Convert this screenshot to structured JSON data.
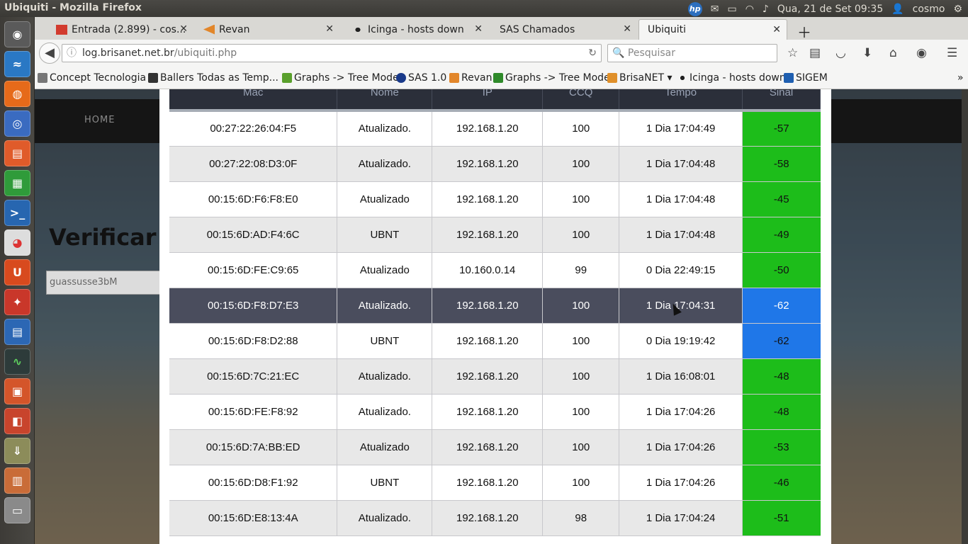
{
  "window_title": "Ubiquiti - Mozilla Firefox",
  "panel": {
    "datetime": "Qua, 21 de Set 09:35",
    "user": "cosmo"
  },
  "tabs": [
    {
      "label": "Entrada (2.899) - cos...",
      "active": false
    },
    {
      "label": "Revan",
      "active": false
    },
    {
      "label": "Icinga - hosts down",
      "active": false
    },
    {
      "label": "SAS Chamados",
      "active": false
    },
    {
      "label": "Ubiquiti",
      "active": true
    }
  ],
  "address": {
    "domain": "log.brisanet.net.br",
    "path": "/ubiquiti.php"
  },
  "search": {
    "placeholder": "Pesquisar"
  },
  "bookmarks": [
    "Concept Tecnologia",
    "Ballers Todas as Temp...",
    "Graphs -> Tree Mode",
    "SAS 1.0",
    "Revan",
    "Graphs -> Tree Mode",
    "BrisaNET",
    "Icinga - hosts down",
    "SIGEM"
  ],
  "site": {
    "nav_home": "HOME",
    "title": "Verificar",
    "input_value": "guassusse3bM"
  },
  "table": {
    "columns": [
      "Mac",
      "Nome",
      "IP",
      "CCQ",
      "Tempo",
      "Sinal"
    ],
    "rows": [
      {
        "mac": "00:27:22:26:04:F5",
        "nome": "Atualizado.",
        "ip": "192.168.1.20",
        "ccq": "100",
        "tempo": "1 Dia 17:04:49",
        "sinal": "-57",
        "color": "green"
      },
      {
        "mac": "00:27:22:08:D3:0F",
        "nome": "Atualizado.",
        "ip": "192.168.1.20",
        "ccq": "100",
        "tempo": "1 Dia 17:04:48",
        "sinal": "-58",
        "color": "green"
      },
      {
        "mac": "00:15:6D:F6:F8:E0",
        "nome": "Atualizado",
        "ip": "192.168.1.20",
        "ccq": "100",
        "tempo": "1 Dia 17:04:48",
        "sinal": "-45",
        "color": "green"
      },
      {
        "mac": "00:15:6D:AD:F4:6C",
        "nome": "UBNT",
        "ip": "192.168.1.20",
        "ccq": "100",
        "tempo": "1 Dia 17:04:48",
        "sinal": "-49",
        "color": "green"
      },
      {
        "mac": "00:15:6D:FE:C9:65",
        "nome": "Atualizado",
        "ip": "10.160.0.14",
        "ccq": "99",
        "tempo": "0 Dia 22:49:15",
        "sinal": "-50",
        "color": "green"
      },
      {
        "mac": "00:15:6D:F8:D7:E3",
        "nome": "Atualizado.",
        "ip": "192.168.1.20",
        "ccq": "100",
        "tempo": "1 Dia 17:04:31",
        "sinal": "-62",
        "color": "blue",
        "highlight": true
      },
      {
        "mac": "00:15:6D:F8:D2:88",
        "nome": "UBNT",
        "ip": "192.168.1.20",
        "ccq": "100",
        "tempo": "0 Dia 19:19:42",
        "sinal": "-62",
        "color": "blue"
      },
      {
        "mac": "00:15:6D:7C:21:EC",
        "nome": "Atualizado.",
        "ip": "192.168.1.20",
        "ccq": "100",
        "tempo": "1 Dia 16:08:01",
        "sinal": "-48",
        "color": "green"
      },
      {
        "mac": "00:15:6D:FE:F8:92",
        "nome": "Atualizado.",
        "ip": "192.168.1.20",
        "ccq": "100",
        "tempo": "1 Dia 17:04:26",
        "sinal": "-48",
        "color": "green"
      },
      {
        "mac": "00:15:6D:7A:BB:ED",
        "nome": "Atualizado",
        "ip": "192.168.1.20",
        "ccq": "100",
        "tempo": "1 Dia 17:04:26",
        "sinal": "-53",
        "color": "green"
      },
      {
        "mac": "00:15:6D:D8:F1:92",
        "nome": "UBNT",
        "ip": "192.168.1.20",
        "ccq": "100",
        "tempo": "1 Dia 17:04:26",
        "sinal": "-46",
        "color": "green"
      },
      {
        "mac": "00:15:6D:E8:13:4A",
        "nome": "Atualizado.",
        "ip": "192.168.1.20",
        "ccq": "98",
        "tempo": "1 Dia 17:04:24",
        "sinal": "-51",
        "color": "green"
      }
    ]
  }
}
